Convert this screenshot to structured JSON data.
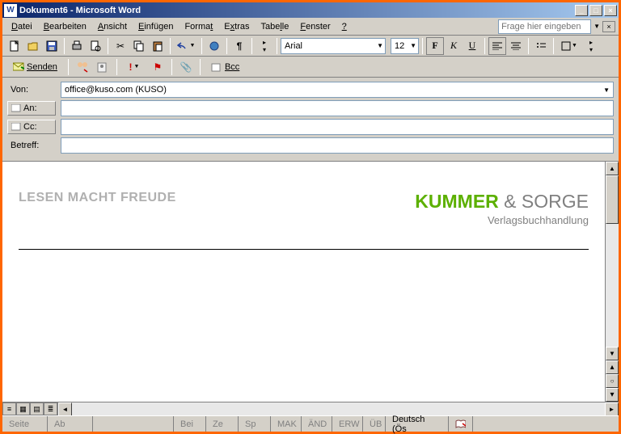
{
  "title": "Dokument6 - Microsoft Word",
  "menu": [
    "Datei",
    "Bearbeiten",
    "Ansicht",
    "Einfügen",
    "Format",
    "Extras",
    "Tabelle",
    "Fenster",
    "?"
  ],
  "help_placeholder": "Frage hier eingeben",
  "font": {
    "name": "Arial",
    "size": "12"
  },
  "email": {
    "send": "Senden",
    "bcc": "Bcc",
    "von_label": "Von:",
    "von_value": "office@kuso.com   (KUSO)",
    "an_label": "An:",
    "an_value": "",
    "cc_label": "Cc:",
    "cc_value": "",
    "betreff_label": "Betreff:",
    "betreff_value": ""
  },
  "document": {
    "slogan": "LESEN MACHT FREUDE",
    "company_green": "KUMMER",
    "company_gray": " & SORGE",
    "subtitle": "Verlagsbuchhandlung"
  },
  "status": {
    "seite": "Seite",
    "ab": "Ab",
    "bei": "Bei",
    "ze": "Ze",
    "sp": "Sp",
    "mak": "MAK",
    "and": "ÄND",
    "erw": "ERW",
    "ub": "ÜB",
    "lang": "Deutsch (Ös"
  }
}
